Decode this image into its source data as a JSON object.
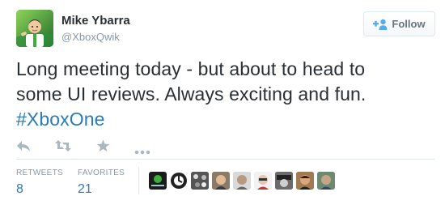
{
  "tweet": {
    "author": {
      "display_name": "Mike Ybarra",
      "screen_name": "@XboxQwik",
      "avatar_icon": "xbox-avatar-icon"
    },
    "follow_button": {
      "label": "Follow",
      "icon": "add-user-icon"
    },
    "text": {
      "line1": "Long meeting today - but about to head to",
      "line2": "some UI reviews. Always exciting and fun.",
      "hashtag": "#XboxOne"
    },
    "actions": [
      {
        "name": "reply",
        "icon": "reply-icon"
      },
      {
        "name": "retweet",
        "icon": "retweet-icon"
      },
      {
        "name": "favorite",
        "icon": "star-icon"
      },
      {
        "name": "more",
        "icon": "ellipsis-icon"
      }
    ],
    "stats": {
      "retweets_label": "RETWEETS",
      "retweets_count": "8",
      "favorites_label": "FAVORITES",
      "favorites_count": "21"
    },
    "favoriter_avatars": [
      "avatar-1",
      "avatar-2",
      "avatar-3",
      "avatar-4",
      "avatar-5",
      "avatar-6",
      "avatar-7",
      "avatar-8",
      "avatar-9",
      "avatar-10"
    ]
  },
  "colors": {
    "link": "#2b7bb9",
    "muted": "#8899a6",
    "text": "#292f33",
    "border": "#e1e8ed"
  }
}
